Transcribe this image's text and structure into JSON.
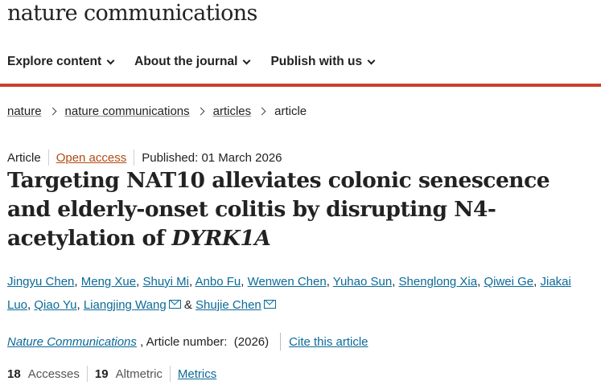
{
  "site": {
    "logo_text": "nature communications"
  },
  "nav": {
    "items": [
      {
        "label": "Explore content"
      },
      {
        "label": "About the journal"
      },
      {
        "label": "Publish with us"
      }
    ]
  },
  "colors": {
    "accent_bar": "#c9422b",
    "link": "#0b6a99",
    "open_access": "#b24b13"
  },
  "breadcrumb": {
    "items": [
      "nature",
      "nature communications",
      "articles"
    ],
    "current": "article"
  },
  "article": {
    "type": "Article",
    "access": "Open access",
    "published": "Published: 01 March 2026",
    "title_main": "Targeting NAT10 alleviates colonic senescence and elderly-onset colitis by disrupting N4-acetylation of ",
    "title_gene": "DYRK1A",
    "authors": [
      "Jingyu Chen",
      "Meng Xue",
      "Shuyi Mi",
      "Anbo Fu",
      "Wenwen Chen",
      "Yuhao Sun",
      "Shenglong Xia",
      "Qiwei Ge",
      "Jiakai Luo",
      "Qiao Yu",
      "Liangjing Wang",
      "Shujie Chen"
    ],
    "author_separator": ", ",
    "author_last_separator": " & ",
    "journal": "Nature Communications",
    "article_number_text": " , Article number:  (2026)",
    "cite_label": "Cite this article"
  },
  "metrics": {
    "accesses_value": "18",
    "accesses_label": "Accesses",
    "altmetric_value": "19",
    "altmetric_label": "Altmetric",
    "metrics_link": "Metrics"
  }
}
